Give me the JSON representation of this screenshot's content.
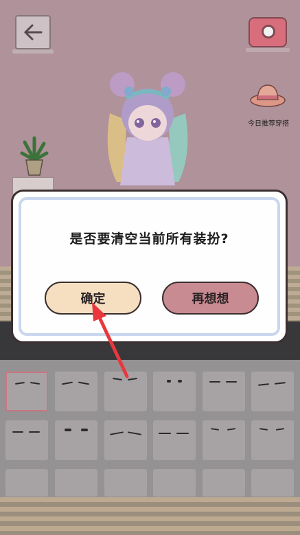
{
  "top_bar": {
    "back_icon": "arrow-left-icon",
    "camera_icon": "camera-icon",
    "recommend_label": "今日推荐穿搭"
  },
  "dialog": {
    "message": "是否要清空当前所有装扮?",
    "confirm_label": "确定",
    "cancel_label": "再想想"
  },
  "colors": {
    "wall": "#b99aa3",
    "confirm_button": "#f5dfc0",
    "cancel_button": "#c98b92",
    "arrow": "#e8383d"
  }
}
